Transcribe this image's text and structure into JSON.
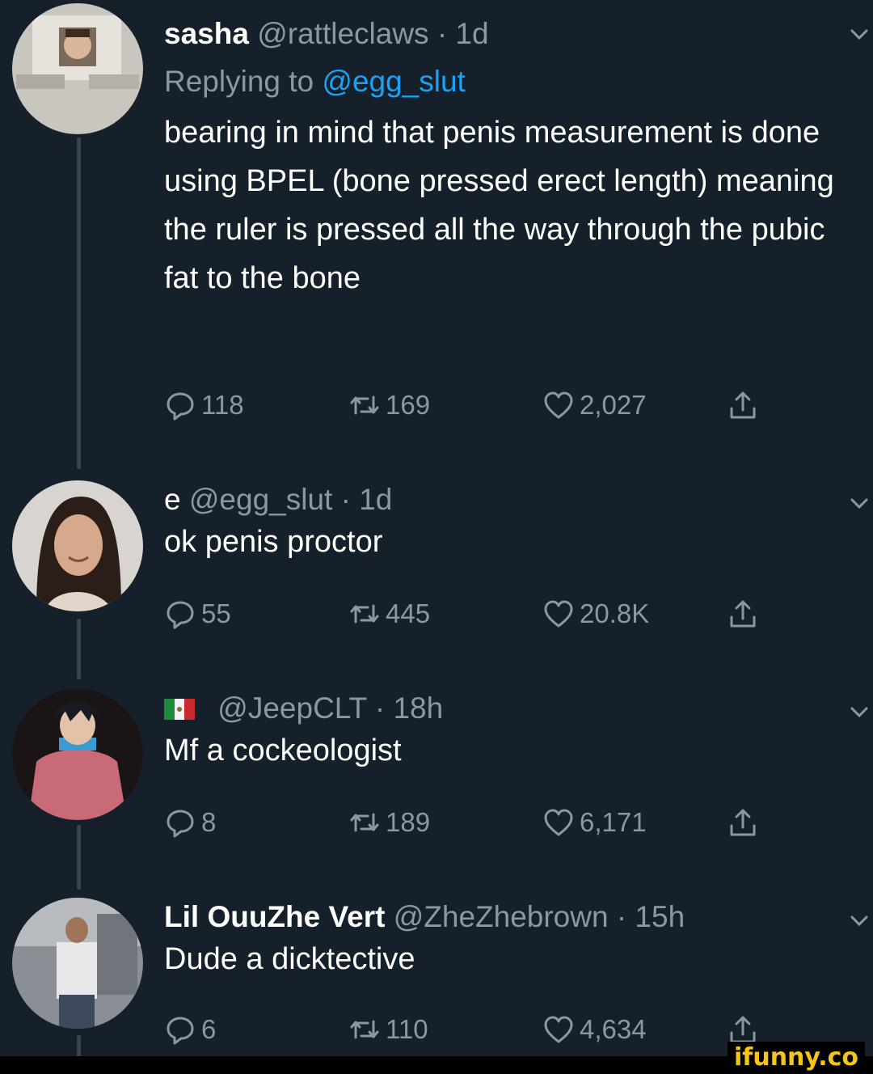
{
  "tweets": [
    {
      "name": "sasha",
      "handle": "@rattleclaws",
      "time": "· 1d",
      "reply_prefix": "Replying to",
      "reply_mention": "@egg_slut",
      "text": "bearing in mind that penis measurement is done using BPEL (bone pressed erect length) meaning the ruler is pressed all the way through the pubic fat to the bone",
      "replies": "118",
      "retweets": "169",
      "likes": "2,027"
    },
    {
      "name": "e",
      "handle": "@egg_slut",
      "time": "· 1d",
      "text": "ok penis proctor",
      "replies": "55",
      "retweets": "445",
      "likes": "20.8K"
    },
    {
      "name": "",
      "handle": "@JeepCLT",
      "time": "· 18h",
      "text": "Mf a cockeologist",
      "replies": "8",
      "retweets": "189",
      "likes": "6,171"
    },
    {
      "name": "Lil OuuZhe Vert",
      "handle": "@ZheZhebrown",
      "time": "· 15h",
      "text": "Dude a dicktective",
      "replies": "6",
      "retweets": "110",
      "likes": "4,634"
    }
  ],
  "icons": {
    "reply": "reply-icon",
    "retweet": "retweet-icon",
    "like": "heart-icon",
    "share": "share-icon",
    "menu": "chevron-down-icon",
    "flag": "mexico-flag-icon"
  },
  "colors": {
    "background": "#15202b",
    "secondary_text": "#8899a6",
    "link": "#1da1f2",
    "thread_line": "#38444d"
  },
  "watermark": "ifunny.co"
}
